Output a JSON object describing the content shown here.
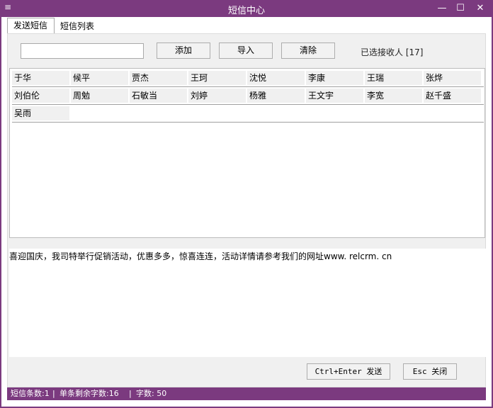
{
  "window": {
    "title": "短信中心",
    "menu_glyph": "≡",
    "minimize_glyph": "—",
    "maximize_glyph": "☐",
    "close_glyph": "✕"
  },
  "tabs": [
    {
      "label": "发送短信",
      "active": true
    },
    {
      "label": "短信列表",
      "active": false
    }
  ],
  "toolbar": {
    "input_value": "",
    "add_label": "添加",
    "import_label": "导入",
    "clear_label": "清除",
    "selected_text": "已选接收人 [17]"
  },
  "recipients": [
    [
      "于华",
      "候平",
      "贾杰",
      "王珂",
      "沈悦",
      "李康",
      "王瑞",
      "张烨"
    ],
    [
      "刘伯伦",
      "周勉",
      "石敏当",
      "刘婷",
      "杨雅",
      "王文宇",
      "李宽",
      "赵千盛"
    ],
    [
      "吴雨"
    ]
  ],
  "message": {
    "text": "喜迎国庆，我司特举行促销活动，优惠多多，惊喜连连，活动详情请参考我们的网址www. relcrm. cn"
  },
  "actions": {
    "send_label": "Ctrl+Enter 发送",
    "close_label": "Esc 关闭"
  },
  "status": {
    "count": "短信条数:1",
    "remaining": "单条剩余字数:16",
    "chars": "字数: 50",
    "divider": "|"
  },
  "colors": {
    "accent": "#7b3a7f",
    "panel": "#f0f0f0",
    "cell": "#f0f0f0"
  }
}
